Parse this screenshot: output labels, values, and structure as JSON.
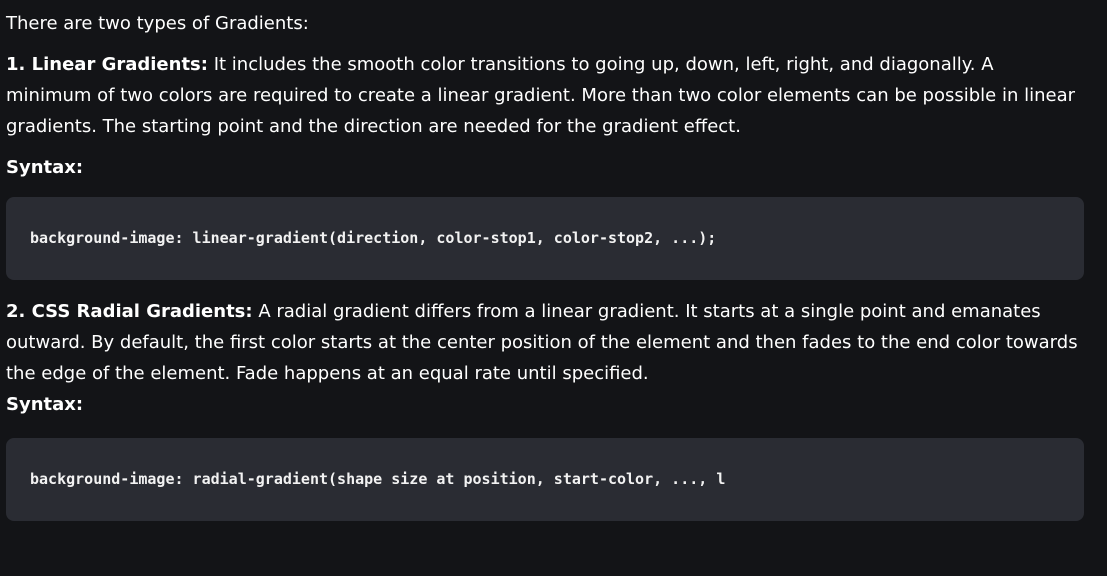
{
  "intro": "There are two types of Gradients:",
  "linear": {
    "title": "1. Linear Gradients:",
    "text": " It includes the smooth color transitions to going up, down, left, right, and diagonally. A minimum of two colors are required to create a linear gradient. More than two color elements can be possible in linear gradients. The starting point and the direction are needed for the gradient effect."
  },
  "syntax_label_1": "Syntax:",
  "code_1": "background-image: linear-gradient(direction, color-stop1, color-stop2, ...);",
  "radial": {
    "title": "2. CSS Radial Gradients:",
    "text": " A radial gradient differs from a linear gradient. It starts at a single point and emanates outward. By default, the first color starts at the center position of the element and then fades to the end color towards the edge of the element. Fade happens at an equal rate until specified."
  },
  "syntax_label_2": "Syntax:",
  "code_2": "background-image: radial-gradient(shape size at position, start-color, ..., l"
}
